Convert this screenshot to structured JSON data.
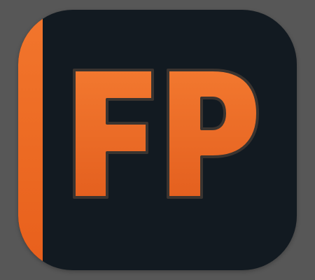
{
  "icon": {
    "name": "app-icon",
    "logo_text": "FP",
    "colors": {
      "background": "#575757",
      "tile": "#121a21",
      "accent": "#ef6e27",
      "letter_top": "#f2782f",
      "letter_bottom": "#e4601f",
      "letter_outline": "#3a3430"
    }
  }
}
